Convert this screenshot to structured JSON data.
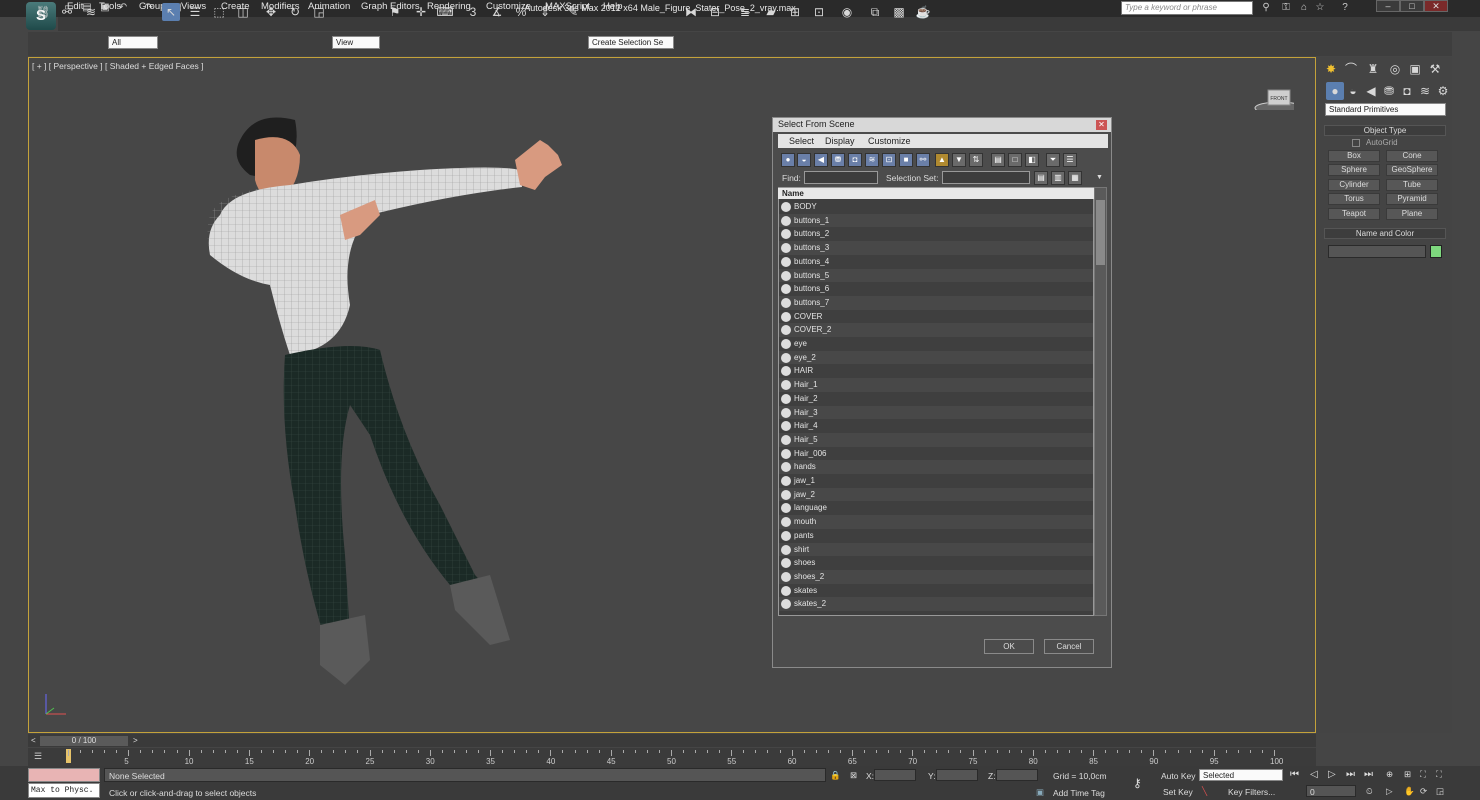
{
  "app": {
    "title": "Autodesk 3ds Max  2012 x64      Male_Figure_Stater_Pose_2_vray.max",
    "logo": "S"
  },
  "search": {
    "placeholder": "Type a keyword or phrase"
  },
  "menu": [
    "Edit",
    "Tools",
    "Group",
    "Views",
    "Create",
    "Modifiers",
    "Animation",
    "Graph Editors",
    "Rendering",
    "Customize",
    "MAXScript",
    "Help"
  ],
  "toolbar": {
    "filter_value": "All",
    "ref_coord": "View",
    "selection_set_placeholder": "Create Selection Se",
    "snap_label": "3"
  },
  "viewport": {
    "label": "[ + ] [ Perspective ] [ Shaded + Edged Faces ]",
    "viewcube_label": "FRONT"
  },
  "command_panel": {
    "dropdown": "Standard Primitives",
    "object_type_title": "Object Type",
    "autogrid": "AutoGrid",
    "buttons": [
      "Box",
      "Cone",
      "Sphere",
      "GeoSphere",
      "Cylinder",
      "Tube",
      "Torus",
      "Pyramid",
      "Teapot",
      "Plane"
    ],
    "name_color_title": "Name and Color",
    "swatch_color": "#7ed87e"
  },
  "dialog": {
    "title": "Select From Scene",
    "menus": [
      "Select",
      "Display",
      "Customize"
    ],
    "find_label": "Find:",
    "selection_set_label": "Selection Set:",
    "column_header": "Name",
    "items": [
      "BODY",
      "buttons_1",
      "buttons_2",
      "buttons_3",
      "buttons_4",
      "buttons_5",
      "buttons_6",
      "buttons_7",
      "COVER",
      "COVER_2",
      "eye",
      "eye_2",
      "HAIR",
      "Hair_1",
      "Hair_2",
      "Hair_3",
      "Hair_4",
      "Hair_5",
      "Hair_006",
      "hands",
      "jaw_1",
      "jaw_2",
      "language",
      "mouth",
      "pants",
      "shirt",
      "shoes",
      "shoes_2",
      "skates",
      "skates_2"
    ],
    "ok": "OK",
    "cancel": "Cancel"
  },
  "timeline": {
    "frame_counter": "0 / 100",
    "ticks": [
      "5",
      "10",
      "15",
      "20",
      "25",
      "30",
      "35",
      "40",
      "45",
      "50",
      "55",
      "60",
      "65",
      "70",
      "75",
      "80",
      "85",
      "90",
      "95",
      "100"
    ]
  },
  "status": {
    "script_box": "Max to Physc.",
    "selection": "None Selected",
    "prompt": "Click or click-and-drag to select objects",
    "x_label": "X:",
    "y_label": "Y:",
    "z_label": "Z:",
    "grid": "Grid = 10,0cm",
    "add_time_tag": "Add Time Tag",
    "auto_key": "Auto Key",
    "set_key": "Set Key",
    "key_mode": "Selected",
    "key_filters": "Key Filters...",
    "current_frame": "0"
  }
}
